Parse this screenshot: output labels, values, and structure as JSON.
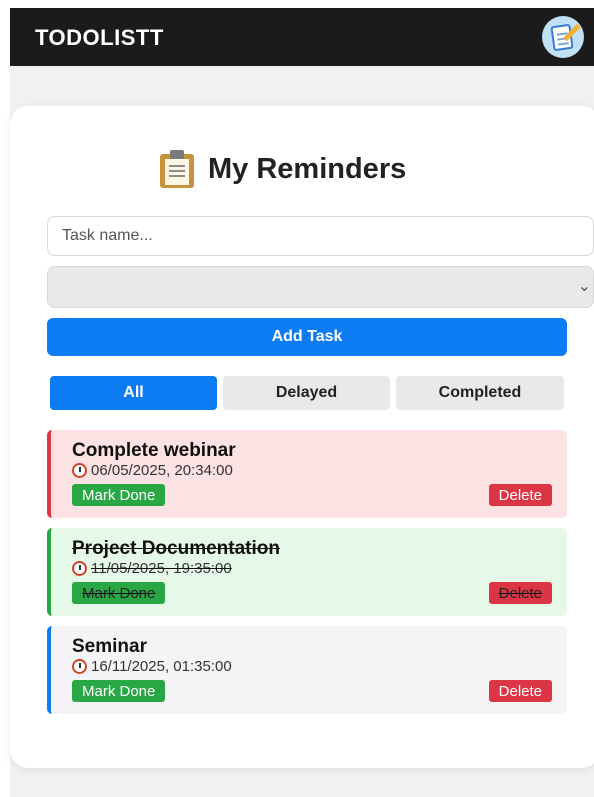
{
  "header": {
    "title": "TODOLISTT",
    "icon": "notepad-pencil-icon"
  },
  "main": {
    "heading": "My Reminders",
    "heading_icon": "clipboard-icon",
    "task_input": {
      "placeholder": "Task name...",
      "value": ""
    },
    "select": {
      "value": ""
    },
    "add_button": "Add Task",
    "tabs": [
      {
        "label": "All",
        "active": true
      },
      {
        "label": "Delayed",
        "active": false
      },
      {
        "label": "Completed",
        "active": false
      }
    ],
    "tasks": [
      {
        "name": "Complete webinar",
        "datetime": "06/05/2025, 20:34:00",
        "done_label": "Mark Done",
        "delete_label": "Delete",
        "status": "delayed"
      },
      {
        "name": "Project Documentation",
        "datetime": "11/05/2025, 19:35:00",
        "done_label": "Mark Done",
        "delete_label": "Delete",
        "status": "completed"
      },
      {
        "name": "Seminar",
        "datetime": "16/11/2025, 01:35:00",
        "done_label": "Mark Done",
        "delete_label": "Delete",
        "status": "pending"
      }
    ]
  },
  "colors": {
    "topbar": "#1b1b1b",
    "accent": "#0d7cf2",
    "delayed_bg": "#fde2e4",
    "delayed_border": "#dc3545",
    "completed_bg": "#e6f8e8",
    "completed_border": "#2aa745",
    "pending_bg": "#f4f4f6",
    "pending_border": "#0d7cf2",
    "done_button": "#2aa745",
    "delete_button": "#dc3545"
  }
}
